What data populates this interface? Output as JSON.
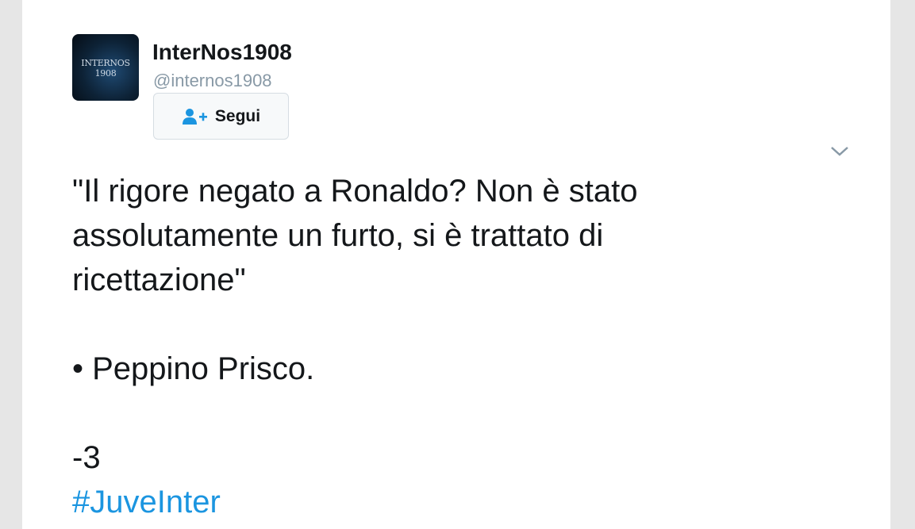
{
  "profile": {
    "avatar_text": "INTERNOS 1908",
    "display_name": "InterNos1908",
    "handle": "@internos1908",
    "follow_label": "Segui",
    "follow_icon": "add-user-icon",
    "menu_icon": "chevron-down-icon"
  },
  "tweet": {
    "line1": "\"Il rigore negato a Ronaldo? Non è stato",
    "line2": "assolutamente un furto, si è trattato di",
    "line3": "ricettazione\"",
    "attribution": "• Peppino Prisco.",
    "counter": "-3",
    "hashtag": "#JuveInter"
  },
  "colors": {
    "accent": "#1b95e0",
    "text": "#14171a",
    "muted": "#8899a6",
    "background": "#e6e6e6"
  }
}
